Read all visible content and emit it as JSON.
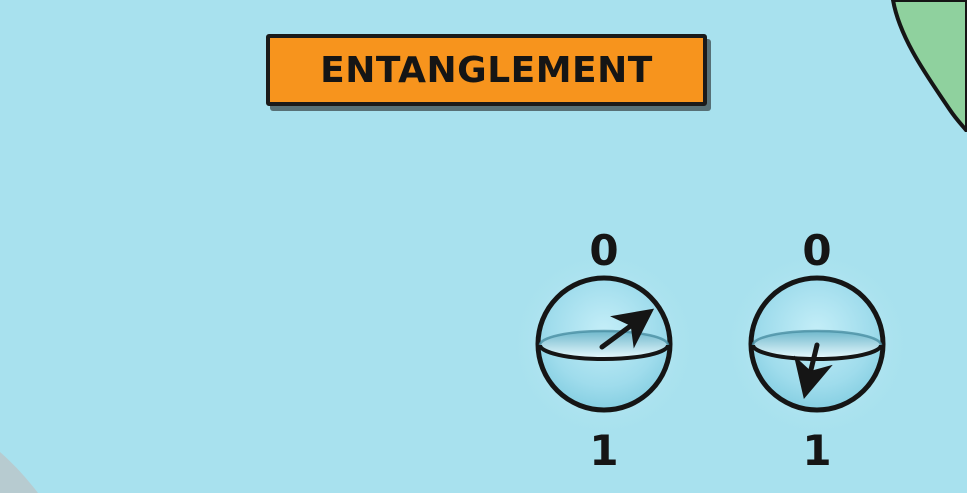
{
  "title": "ENTANGLEMENT",
  "colors": {
    "background": "#a8e1ee",
    "banner": "#f7941d",
    "outline": "#151515",
    "blob": "#8fd19e",
    "sphere_fill": "#9fdcec"
  },
  "qubits": [
    {
      "top_label": "0",
      "bottom_label": "1",
      "arrow": "arrow-up-right-icon"
    },
    {
      "top_label": "0",
      "bottom_label": "1",
      "arrow": "arrow-down-icon"
    }
  ]
}
